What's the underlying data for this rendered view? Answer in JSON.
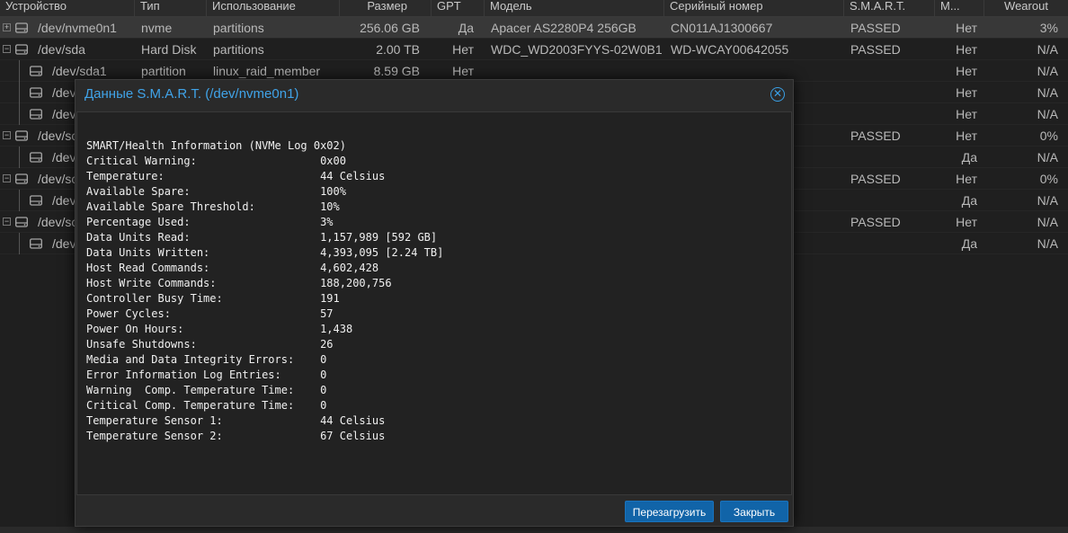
{
  "columns": {
    "device": "Устройство",
    "type": "Тип",
    "usage": "Использование",
    "size": "Размер",
    "gpt": "GPT",
    "model": "Модель",
    "serial": "Серийный номер",
    "smart": "S.M.A.R.T.",
    "m": "М...",
    "wearout": "Wearout"
  },
  "rows": [
    {
      "device": "/dev/nvme0n1",
      "type": "nvme",
      "usage": "partitions",
      "size": "256.06 GB",
      "gpt": "Да",
      "model": "Apacer AS2280P4 256GB",
      "serial": "CN011AJ1300667",
      "smart": "PASSED",
      "m": "Нет",
      "wearout": "3%"
    },
    {
      "device": "/dev/sda",
      "type": "Hard Disk",
      "usage": "partitions",
      "size": "2.00 TB",
      "gpt": "Нет",
      "model": "WDC_WD2003FYYS-02W0B1",
      "serial": "WD-WCAY00642055",
      "smart": "PASSED",
      "m": "Нет",
      "wearout": "N/A"
    },
    {
      "device": "/dev/sda1",
      "type": "partition",
      "usage": "linux_raid_member",
      "size": "8.59 GB",
      "gpt": "Нет",
      "model": "",
      "serial": "",
      "smart": "",
      "m": "Нет",
      "wearout": "N/A"
    },
    {
      "device": "/dev",
      "type": "",
      "usage": "",
      "size": "",
      "gpt": "",
      "model": "",
      "serial": "",
      "smart": "",
      "m": "Нет",
      "wearout": "N/A"
    },
    {
      "device": "/dev",
      "type": "",
      "usage": "",
      "size": "",
      "gpt": "",
      "model": "",
      "serial": "",
      "smart": "",
      "m": "Нет",
      "wearout": "N/A"
    },
    {
      "device": "/dev/sc",
      "type": "",
      "usage": "",
      "size": "",
      "gpt": "",
      "model": "",
      "serial": "",
      "smart": "PASSED",
      "m": "Нет",
      "wearout": "0%"
    },
    {
      "device": "/dev",
      "type": "",
      "usage": "",
      "size": "",
      "gpt": "",
      "model": "",
      "serial": "",
      "smart": "",
      "m": "Да",
      "wearout": "N/A"
    },
    {
      "device": "/dev/sc",
      "type": "",
      "usage": "",
      "size": "",
      "gpt": "",
      "model": "",
      "serial": "",
      "smart": "PASSED",
      "m": "Нет",
      "wearout": "0%"
    },
    {
      "device": "/dev",
      "type": "",
      "usage": "",
      "size": "",
      "gpt": "",
      "model": "",
      "serial": "",
      "smart": "",
      "m": "Да",
      "wearout": "N/A"
    },
    {
      "device": "/dev/sc",
      "type": "",
      "usage": "",
      "size": "",
      "gpt": "",
      "model": "",
      "serial": "",
      "smart": "PASSED",
      "m": "Нет",
      "wearout": "N/A"
    },
    {
      "device": "/dev",
      "type": "",
      "usage": "",
      "size": "",
      "gpt": "",
      "model": "",
      "serial": "",
      "smart": "",
      "m": "Да",
      "wearout": "N/A"
    }
  ],
  "modal": {
    "title": "Данные S.M.A.R.T. (/dev/nvme0n1)",
    "close_icon": "close-circle-icon",
    "smart_text": "SMART/Health Information (NVMe Log 0x02)\nCritical Warning:                   0x00\nTemperature:                        44 Celsius\nAvailable Spare:                    100%\nAvailable Spare Threshold:          10%\nPercentage Used:                    3%\nData Units Read:                    1,157,989 [592 GB]\nData Units Written:                 4,393,095 [2.24 TB]\nHost Read Commands:                 4,602,428\nHost Write Commands:                188,200,756\nController Busy Time:               191\nPower Cycles:                       57\nPower On Hours:                     1,438\nUnsafe Shutdowns:                   26\nMedia and Data Integrity Errors:    0\nError Information Log Entries:      0\nWarning  Comp. Temperature Time:    0\nCritical Comp. Temperature Time:    0\nTemperature Sensor 1:               44 Celsius\nTemperature Sensor 2:               67 Celsius",
    "reload_label": "Перезагрузить",
    "close_label": "Закрыть"
  },
  "colors": {
    "accent": "#40a3e8",
    "button": "#1164a8"
  }
}
